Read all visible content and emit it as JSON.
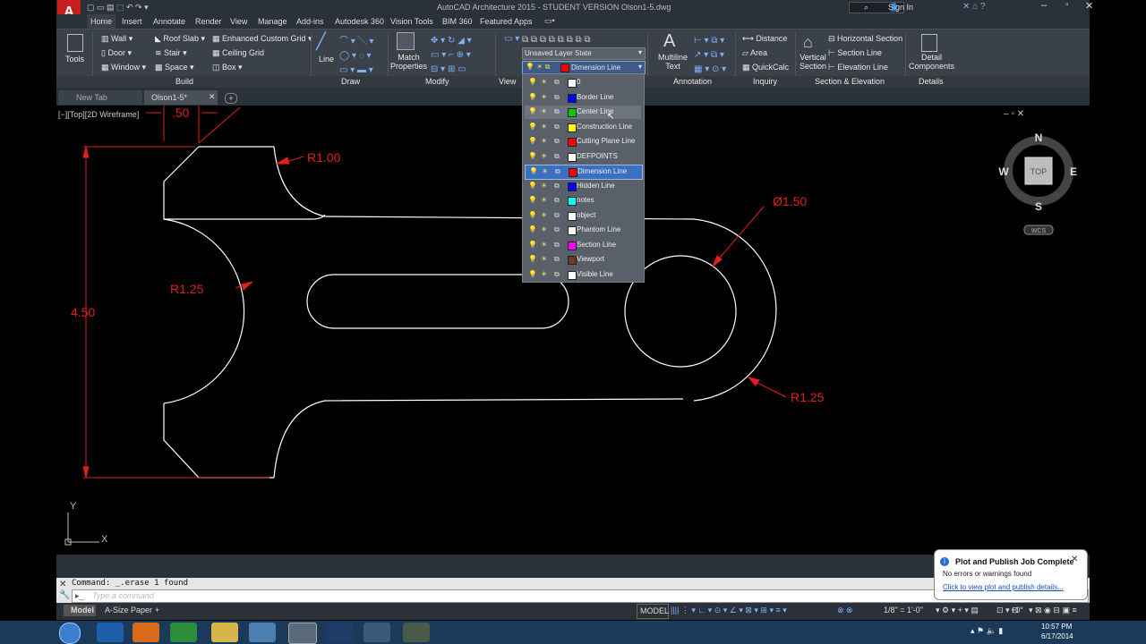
{
  "app": {
    "title": "AutoCAD Architecture 2015 - STUDENT VERSION   Olson1-5.dwg",
    "sign_in": "Sign In",
    "logo": "A"
  },
  "ribbon_tabs": [
    "Home",
    "Insert",
    "Annotate",
    "Render",
    "View",
    "Manage",
    "Add-ins",
    "Autodesk 360",
    "Vision Tools",
    "BIM 360",
    "Featured Apps"
  ],
  "ribbon": {
    "tools": "Tools",
    "build": {
      "wall": "Wall",
      "door": "Door",
      "window": "Window",
      "roof_slab": "Roof Slab",
      "stair": "Stair",
      "space": "Space",
      "enhanced_grid": "Enhanced Custom Grid",
      "ceiling_grid": "Ceiling Grid",
      "box": "Box"
    },
    "line": "Line",
    "match_properties": "Match\nProperties",
    "layer_state": "Unsaved Layer State",
    "current_layer": "Dimension Line",
    "multiline_text": "Multiline\nText",
    "inquiry": {
      "distance": "Distance",
      "area": "Area",
      "quickcalc": "QuickCalc"
    },
    "vertical_section": "Vertical\nSection",
    "section": {
      "horizontal": "Horizontal Section",
      "section_line": "Section Line",
      "elevation_line": "Elevation Line"
    },
    "detail_components": "Detail\nComponents",
    "panels": [
      "Build",
      "Draw",
      "Modify",
      "View",
      "Annotation",
      "Inquiry",
      "Section & Elevation",
      "Details"
    ]
  },
  "file_tabs": {
    "new_tab": "New Tab",
    "current": "Olson1-5*"
  },
  "viewport_label": "[−][Top][2D Wireframe]",
  "layers": [
    {
      "name": "0",
      "color": "#ffffff"
    },
    {
      "name": "Border Line",
      "color": "#0000ff"
    },
    {
      "name": "Center Line",
      "color": "#00cc00"
    },
    {
      "name": "Construction Line",
      "color": "#ffff00"
    },
    {
      "name": "Cutting Plane Line",
      "color": "#ff0000"
    },
    {
      "name": "DEFPOINTS",
      "color": "#ffffff"
    },
    {
      "name": "Dimension Line",
      "color": "#ff0000"
    },
    {
      "name": "Hidden Line",
      "color": "#0000ff"
    },
    {
      "name": "notes",
      "color": "#00ffff"
    },
    {
      "name": "object",
      "color": "#ffffff"
    },
    {
      "name": "Phantom Line",
      "color": "#ffffff"
    },
    {
      "name": "Section Line",
      "color": "#ff00ff"
    },
    {
      "name": "Viewport",
      "color": "#6a3a2a"
    },
    {
      "name": "Visible Line",
      "color": "#ffffff"
    }
  ],
  "dims": {
    "top": ".50",
    "r1": "R1.00",
    "r2": "R1.25",
    "r3": "R1.25",
    "dia": "Ø1.50",
    "height": "4.50"
  },
  "viewcube": {
    "n": "N",
    "s": "S",
    "e": "E",
    "w": "W",
    "top": "TOP",
    "wcs": "WCS"
  },
  "ucs": {
    "x": "X",
    "y": "Y"
  },
  "command": {
    "history": "Command: _.erase 1 found",
    "placeholder": "Type a command"
  },
  "layout_tabs": [
    "Model",
    "A-Size Paper"
  ],
  "status": {
    "model": "MODEL",
    "scale": "1/8\" = 1'-0\"",
    "angle": "+0°"
  },
  "notification": {
    "title": "Plot and Publish Job Complete",
    "line1": "No errors or warnings found",
    "link": "Click to view plot and publish details..."
  },
  "clock": {
    "time": "10:57 PM",
    "date": "6/17/2014"
  }
}
